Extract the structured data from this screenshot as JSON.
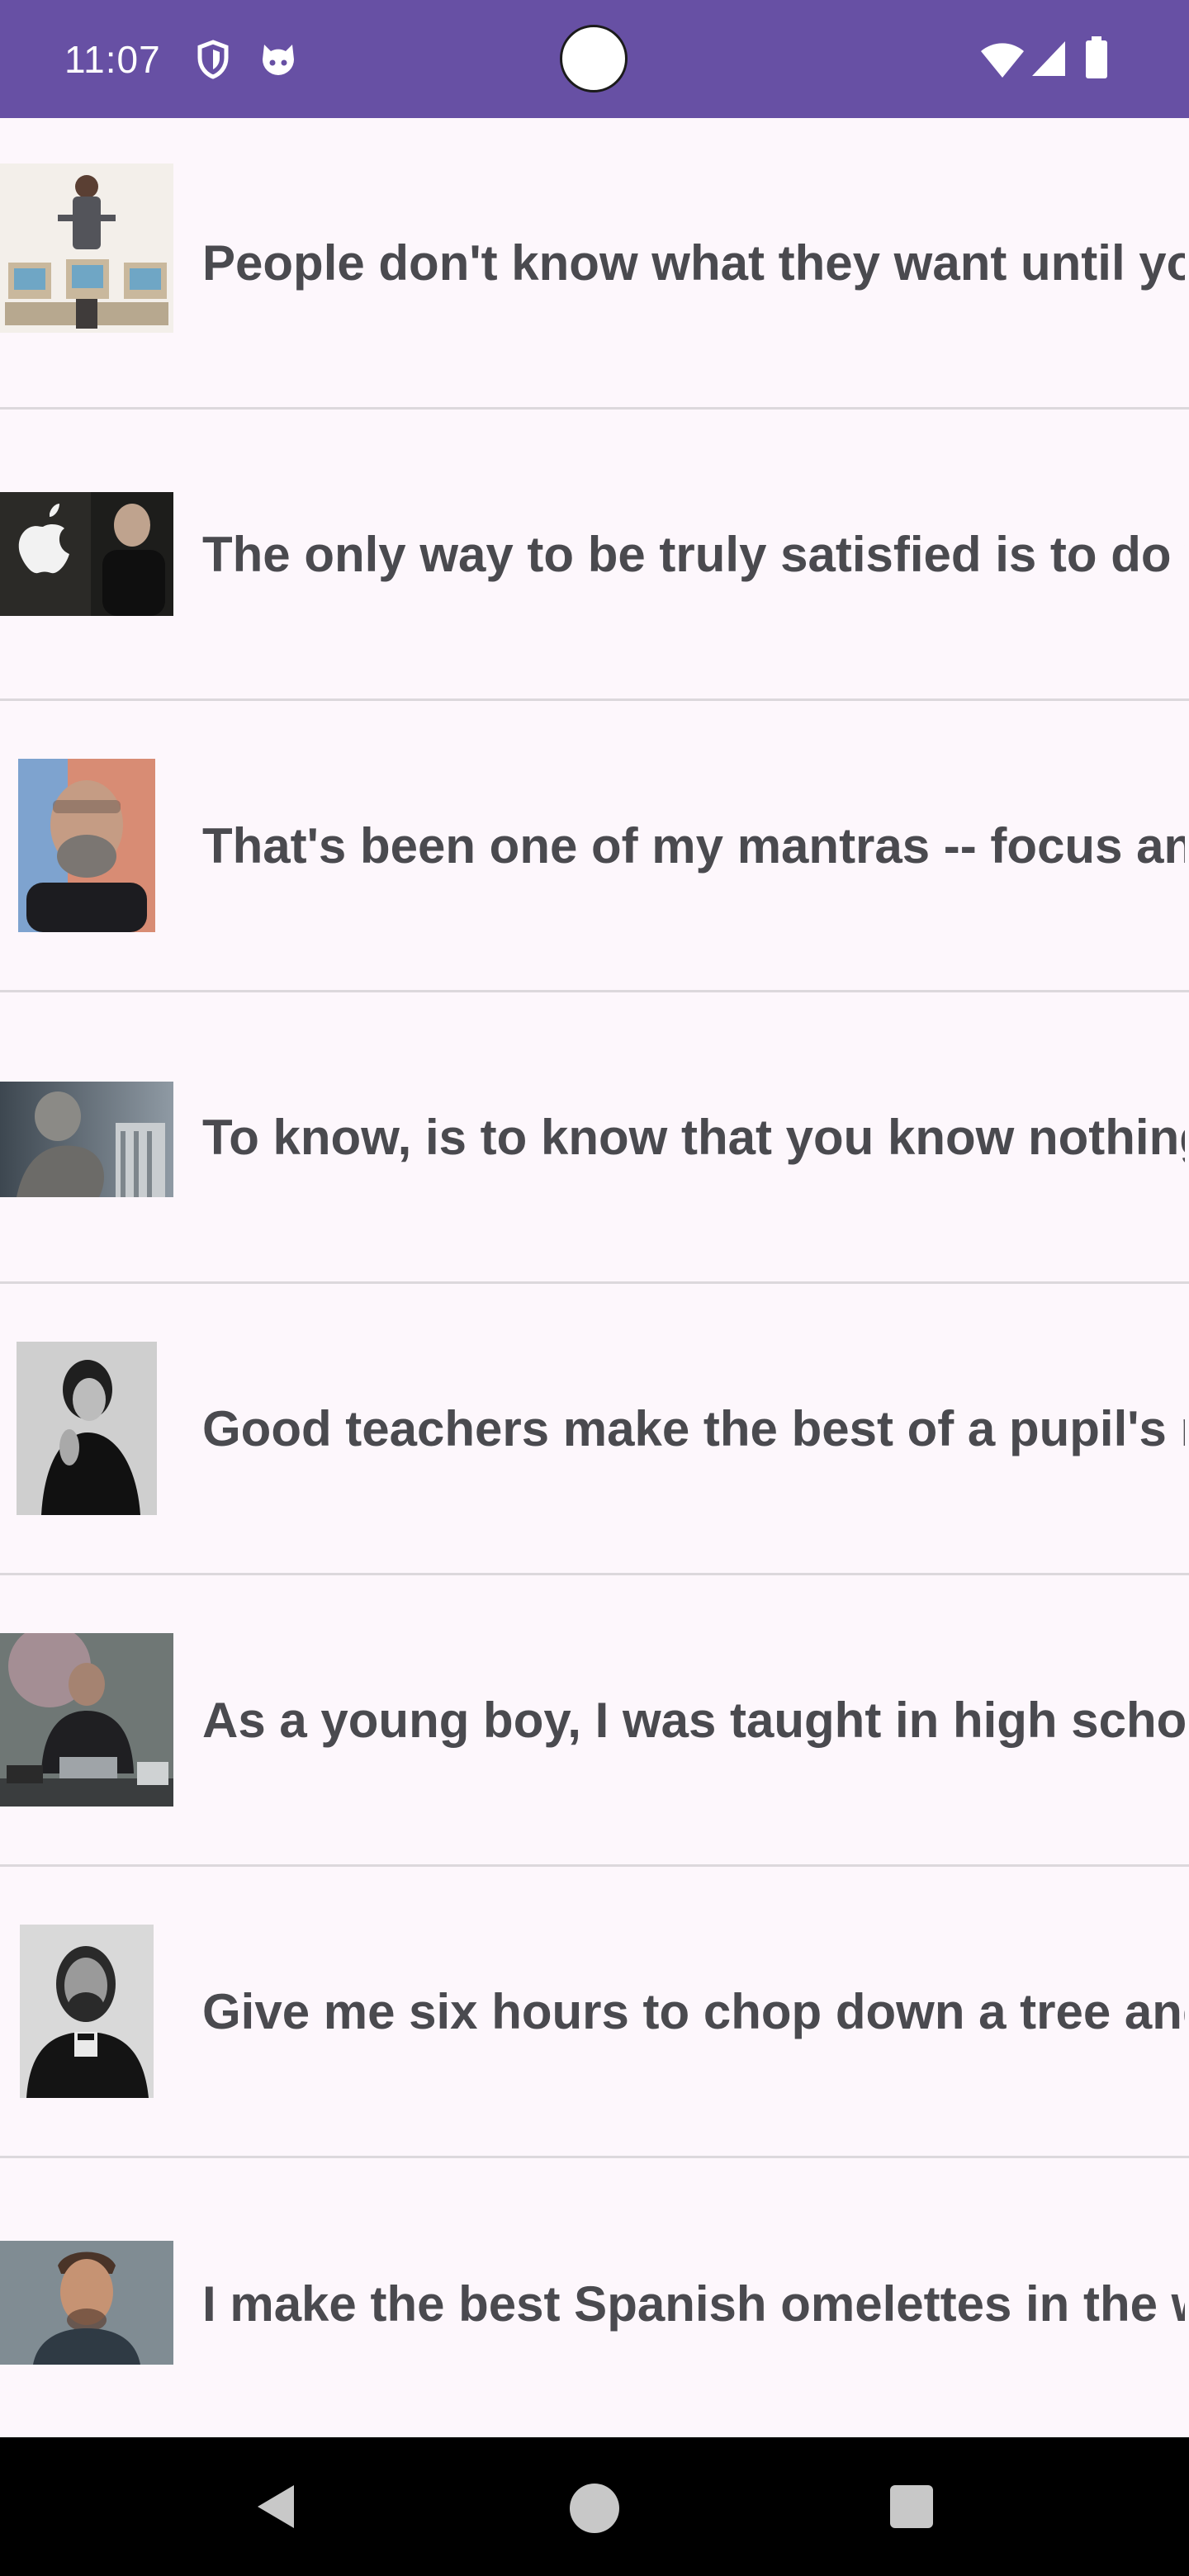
{
  "status_bar": {
    "time": "11:07",
    "icons": [
      "shield-icon",
      "android-cat-icon",
      "wifi-icon",
      "cell-signal-icon",
      "battery-icon"
    ],
    "background": "#6750A4"
  },
  "quotes": [
    {
      "text": "People don't know what they want until you show it to them.",
      "image": "man-with-computers-photo"
    },
    {
      "text": "The only way to be truly satisfied is to do what you believe is great work.",
      "image": "apple-logo-portrait-photo"
    },
    {
      "text": "That's been one of my mantras -- focus and simplicity.",
      "image": "bearded-man-portrait-photo"
    },
    {
      "text": "To know, is to know that you know nothing.",
      "image": "greek-statue-photo"
    },
    {
      "text": "Good teachers make the best of a pupil's means.",
      "image": "woman-bw-portrait-photo"
    },
    {
      "text": "As a young boy, I was taught in high school that hackers were bad.",
      "image": "man-leather-jacket-photo"
    },
    {
      "text": "Give me six hours to chop down a tree and I will spend the first four sharpening the axe.",
      "image": "lincoln-bw-portrait-photo"
    },
    {
      "text": "I make the best Spanish omelettes in the world.",
      "image": "man-portrait-photo"
    }
  ],
  "nav_bar": {
    "buttons": [
      "back-icon",
      "home-icon",
      "recents-icon"
    ]
  },
  "colors": {
    "list_background": "#FDF7FC",
    "divider": "#DCD8DC",
    "quote_text": "#4a4a4f"
  }
}
